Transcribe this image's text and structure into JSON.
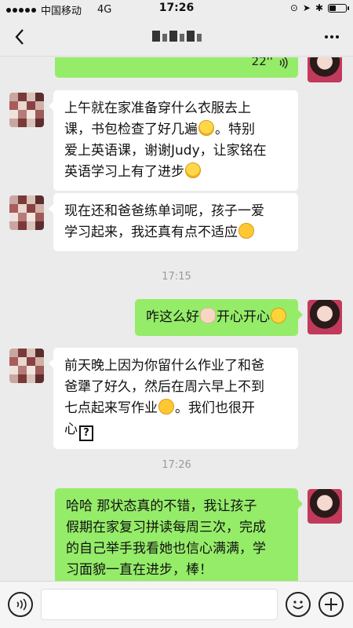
{
  "status_bar": {
    "carrier": "中国移动",
    "network": "4G",
    "time": "17:26",
    "battery_level": 0.35
  },
  "nav": {
    "title": "",
    "back_icon": "chevron-left-icon",
    "more_icon": "more-dots-icon"
  },
  "messages": [
    {
      "type": "voice",
      "from": "self",
      "duration": "22''"
    },
    {
      "type": "text",
      "from": "other",
      "lines": [
        "上午就在家准备穿什么衣服去上",
        "课，书包检查了好几遍",
        "。特别",
        "爱上英语课，谢谢Judy，让家铭在",
        "英语学习上有了进步"
      ]
    },
    {
      "type": "text",
      "from": "other",
      "lines": [
        "现在还和爸爸练单词呢，孩子一爱",
        "学习起来，我还真有点不适应"
      ]
    },
    {
      "type": "time",
      "text": "17:15"
    },
    {
      "type": "text",
      "from": "self",
      "lines": [
        "咋这么好",
        "开心开心"
      ]
    },
    {
      "type": "text",
      "from": "other",
      "lines": [
        "前天晚上因为你留什么作业了和爸",
        "爸犟了好久，然后在周六早上不到",
        "七点起来写作业",
        "。我们也很开",
        "心",
        "?"
      ]
    },
    {
      "type": "time",
      "text": "17:26"
    },
    {
      "type": "text",
      "from": "self",
      "lines": [
        "哈哈 那状态真的不错，我让孩子",
        "假期在家复习拼读每周三次，完成",
        "的自己举手我看她也信心满满，学",
        "习面貌一直在进步，棒！"
      ]
    }
  ],
  "input_bar": {
    "voice_icon": "voice-input-icon",
    "emoji_icon": "emoji-icon",
    "plus_icon": "plus-icon"
  },
  "colors": {
    "self_bubble": "#95ec69",
    "other_bubble": "#ffffff",
    "background": "#ebebeb"
  }
}
